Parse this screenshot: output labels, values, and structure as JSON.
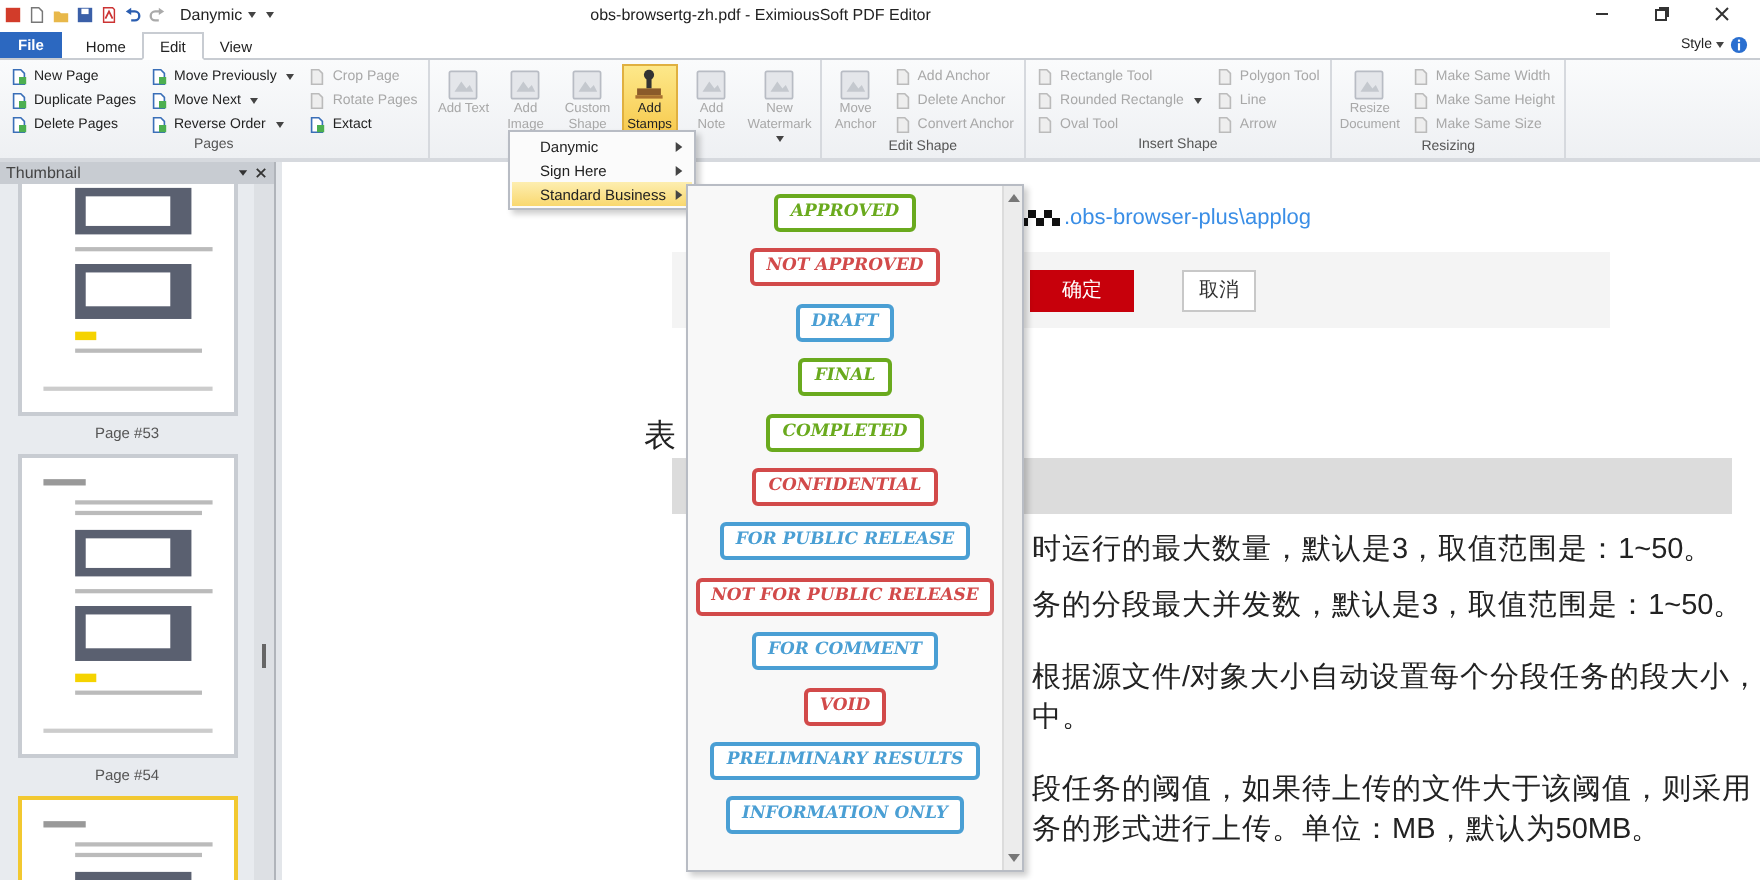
{
  "title_bar": {
    "quick_access_label": "Danymic",
    "title": "obs-browsertg-zh.pdf - EximiousSoft PDF Editor"
  },
  "tabs": [
    {
      "label": "File",
      "kind": "file",
      "selected": false
    },
    {
      "label": "Home",
      "kind": "tab",
      "selected": false
    },
    {
      "label": "Edit",
      "kind": "tab",
      "selected": true
    },
    {
      "label": "View",
      "kind": "tab",
      "selected": false
    }
  ],
  "style_menu": "Style",
  "ribbon_groups": [
    {
      "label": "Pages",
      "columns": [
        [
          {
            "label": "New Page",
            "kind": "small",
            "disabled": false,
            "dropdown": false
          },
          {
            "label": "Duplicate Pages",
            "kind": "small",
            "disabled": false,
            "dropdown": false
          },
          {
            "label": "Delete Pages",
            "kind": "small",
            "disabled": false,
            "dropdown": false
          }
        ],
        [
          {
            "label": "Move Previously",
            "kind": "small",
            "disabled": false,
            "dropdown": true
          },
          {
            "label": "Move Next",
            "kind": "small",
            "disabled": false,
            "dropdown": true
          },
          {
            "label": "Reverse Order",
            "kind": "small",
            "disabled": false,
            "dropdown": true
          }
        ],
        [
          {
            "label": "Crop Page",
            "kind": "small",
            "disabled": true,
            "dropdown": false
          },
          {
            "label": "Rotate Pages",
            "kind": "small",
            "disabled": true,
            "dropdown": false
          },
          {
            "label": "Extact",
            "kind": "small",
            "disabled": false,
            "dropdown": false
          }
        ]
      ]
    },
    {
      "columns": [
        [
          {
            "label": "Add Text",
            "kind": "large",
            "disabled": true,
            "dropdown": false,
            "selected": false
          }
        ],
        [
          {
            "label": "Add Image",
            "kind": "large",
            "disabled": true,
            "dropdown": false,
            "selected": false
          }
        ],
        [
          {
            "label": "Custom Shape",
            "kind": "large",
            "disabled": true,
            "dropdown": false,
            "selected": false
          }
        ],
        [
          {
            "label": "Add Stamps",
            "kind": "large",
            "disabled": false,
            "dropdown": true,
            "selected": true
          }
        ],
        [
          {
            "label": "Add Note",
            "kind": "large",
            "disabled": true,
            "dropdown": false,
            "selected": false
          }
        ],
        [
          {
            "label": "New Watermark",
            "kind": "large",
            "disabled": true,
            "dropdown": true,
            "selected": false
          }
        ]
      ]
    },
    {
      "label": "Edit Shape",
      "columns": [
        [
          {
            "label": "Move Anchor",
            "kind": "large",
            "disabled": true,
            "dropdown": false,
            "selected": false
          }
        ],
        [
          {
            "label": "Add Anchor",
            "kind": "small",
            "disabled": true,
            "dropdown": false
          },
          {
            "label": "Delete Anchor",
            "kind": "small",
            "disabled": true,
            "dropdown": false
          },
          {
            "label": "Convert Anchor",
            "kind": "small",
            "disabled": true,
            "dropdown": false
          }
        ]
      ]
    },
    {
      "label": "Insert Shape",
      "columns": [
        [
          {
            "label": "Rectangle Tool",
            "kind": "small",
            "disabled": true,
            "dropdown": false
          },
          {
            "label": "Rounded Rectangle",
            "kind": "small",
            "disabled": true,
            "dropdown": true
          },
          {
            "label": "Oval Tool",
            "kind": "small",
            "disabled": true,
            "dropdown": false
          }
        ],
        [
          {
            "label": "Polygon Tool",
            "kind": "small",
            "disabled": true,
            "dropdown": false
          },
          {
            "label": "Line",
            "kind": "small",
            "disabled": true,
            "dropdown": false
          },
          {
            "label": "Arrow",
            "kind": "small",
            "disabled": true,
            "dropdown": false
          }
        ]
      ]
    },
    {
      "label": "Resizing",
      "columns": [
        [
          {
            "label": "Resize Document",
            "kind": "large",
            "disabled": true,
            "dropdown": false,
            "selected": false
          }
        ],
        [
          {
            "label": "Make Same Width",
            "kind": "small",
            "disabled": true,
            "dropdown": false
          },
          {
            "label": "Make Same Height",
            "kind": "small",
            "disabled": true,
            "dropdown": false
          },
          {
            "label": "Make Same Size",
            "kind": "small",
            "disabled": true,
            "dropdown": false
          }
        ]
      ]
    }
  ],
  "thumbnail_panel": {
    "title": "Thumbnail",
    "pages": [
      {
        "label": "Page #53",
        "selected": false
      },
      {
        "label": "Page #54",
        "selected": false
      },
      {
        "selected": true
      }
    ]
  },
  "document": {
    "link": ".obs-browser-plus\\applog",
    "ok_button": "确定",
    "cancel_button": "取消",
    "heading_fragment": "表",
    "paragraphs": [
      [
        "时运行的最大数量，默认是3，取值范围是：1~50。"
      ],
      [
        "务的分段最大并发数，默认是3，取值范围是：1~50。"
      ],
      [
        "根据源文件/对象大小自动设置每个分段任务的段大小，",
        "中。"
      ],
      [
        "段任务的阈值，如果待上传的文件大于该阈值，则采用",
        "务的形式进行上传。单位：MB，默认为50MB。"
      ]
    ]
  },
  "stamps_menu": [
    {
      "label": "Danymic",
      "selected": false
    },
    {
      "label": "Sign Here",
      "selected": false
    },
    {
      "label": "Standard Business",
      "selected": true
    }
  ],
  "stamps": [
    {
      "label": "APPROVED",
      "color": "#6aaa1e"
    },
    {
      "label": "NOT APPROVED",
      "color": "#d24a4a"
    },
    {
      "label": "DRAFT",
      "color": "#4a9fd4"
    },
    {
      "label": "FINAL",
      "color": "#6aaa1e"
    },
    {
      "label": "COMPLETED",
      "color": "#6aaa1e"
    },
    {
      "label": "CONFIDENTIAL",
      "color": "#d24a4a"
    },
    {
      "label": "FOR PUBLIC RELEASE",
      "color": "#4a9fd4"
    },
    {
      "label": "NOT FOR PUBLIC RELEASE",
      "color": "#d24a4a"
    },
    {
      "label": "FOR COMMENT",
      "color": "#4a9fd4"
    },
    {
      "label": "VOID",
      "color": "#d24a4a"
    },
    {
      "label": "PRELIMINARY RESULTS",
      "color": "#4a9fd4"
    },
    {
      "label": "INFORMATION ONLY",
      "color": "#4a9fd4"
    }
  ]
}
